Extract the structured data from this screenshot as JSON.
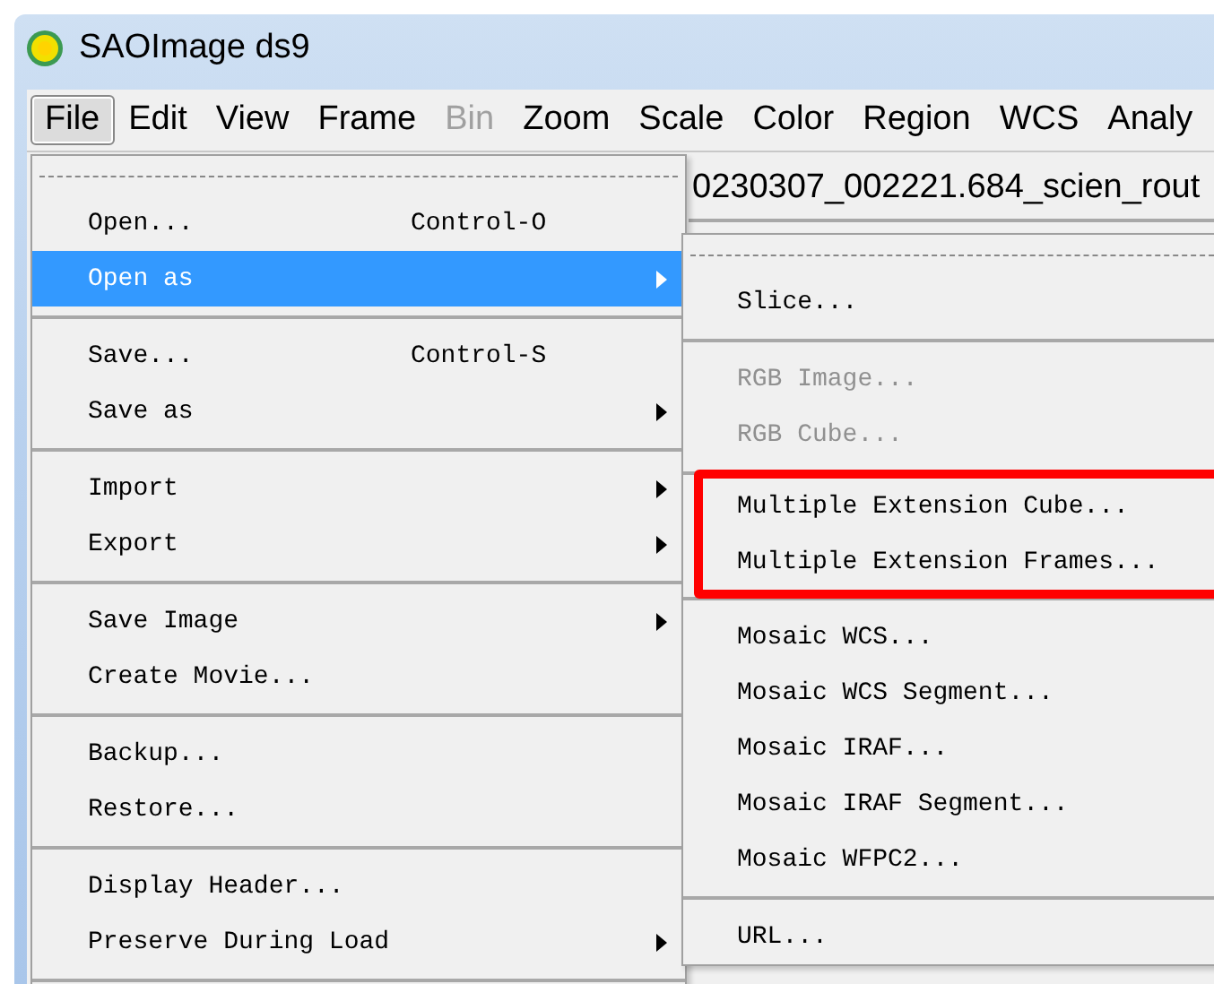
{
  "window": {
    "title": "SAOImage ds9"
  },
  "menubar": [
    {
      "label": "File",
      "selected": true,
      "disabled": false
    },
    {
      "label": "Edit",
      "selected": false,
      "disabled": false
    },
    {
      "label": "View",
      "selected": false,
      "disabled": false
    },
    {
      "label": "Frame",
      "selected": false,
      "disabled": false
    },
    {
      "label": "Bin",
      "selected": false,
      "disabled": true
    },
    {
      "label": "Zoom",
      "selected": false,
      "disabled": false
    },
    {
      "label": "Scale",
      "selected": false,
      "disabled": false
    },
    {
      "label": "Color",
      "selected": false,
      "disabled": false
    },
    {
      "label": "Region",
      "selected": false,
      "disabled": false
    },
    {
      "label": "WCS",
      "selected": false,
      "disabled": false
    },
    {
      "label": "Analy",
      "selected": false,
      "disabled": false
    }
  ],
  "filename": "0230307_002221.684_scien_rout",
  "file_menu": [
    {
      "kind": "tearoff"
    },
    {
      "kind": "item",
      "label": "Open...",
      "shortcut": "Control-O",
      "submenu": false,
      "selected": false
    },
    {
      "kind": "item",
      "label": "Open as",
      "submenu": true,
      "selected": true
    },
    {
      "kind": "separator"
    },
    {
      "kind": "item",
      "label": "Save...",
      "shortcut": "Control-S",
      "submenu": false,
      "selected": false
    },
    {
      "kind": "item",
      "label": "Save as",
      "submenu": true,
      "selected": false
    },
    {
      "kind": "separator"
    },
    {
      "kind": "item",
      "label": "Import",
      "submenu": true,
      "selected": false
    },
    {
      "kind": "item",
      "label": "Export",
      "submenu": true,
      "selected": false
    },
    {
      "kind": "separator"
    },
    {
      "kind": "item",
      "label": "Save Image",
      "submenu": true,
      "selected": false
    },
    {
      "kind": "item",
      "label": "Create Movie...",
      "submenu": false,
      "selected": false
    },
    {
      "kind": "separator"
    },
    {
      "kind": "item",
      "label": "Backup...",
      "submenu": false,
      "selected": false
    },
    {
      "kind": "item",
      "label": "Restore...",
      "submenu": false,
      "selected": false
    },
    {
      "kind": "separator"
    },
    {
      "kind": "item",
      "label": "Display Header...",
      "submenu": false,
      "selected": false
    },
    {
      "kind": "item",
      "label": "Preserve During Load",
      "submenu": true,
      "selected": false
    },
    {
      "kind": "separator"
    }
  ],
  "open_as_menu": [
    {
      "kind": "tearoff"
    },
    {
      "kind": "item",
      "label": "Slice...",
      "disabled": false,
      "annotated": false
    },
    {
      "kind": "separator"
    },
    {
      "kind": "item",
      "label": "RGB Image...",
      "disabled": true,
      "annotated": false
    },
    {
      "kind": "item",
      "label": "RGB Cube...",
      "disabled": true,
      "annotated": false
    },
    {
      "kind": "separator"
    },
    {
      "kind": "item",
      "label": "Multiple Extension Cube...",
      "disabled": false,
      "annotated": true
    },
    {
      "kind": "item",
      "label": "Multiple Extension Frames...",
      "disabled": false,
      "annotated": true
    },
    {
      "kind": "separator"
    },
    {
      "kind": "item",
      "label": "Mosaic WCS...",
      "disabled": false,
      "annotated": false
    },
    {
      "kind": "item",
      "label": "Mosaic WCS Segment...",
      "disabled": false,
      "annotated": false
    },
    {
      "kind": "item",
      "label": "Mosaic IRAF...",
      "disabled": false,
      "annotated": false
    },
    {
      "kind": "item",
      "label": "Mosaic IRAF Segment...",
      "disabled": false,
      "annotated": false
    },
    {
      "kind": "item",
      "label": "Mosaic WFPC2...",
      "disabled": false,
      "annotated": false
    },
    {
      "kind": "separator"
    },
    {
      "kind": "item",
      "label": "URL...",
      "disabled": false,
      "annotated": false
    }
  ]
}
